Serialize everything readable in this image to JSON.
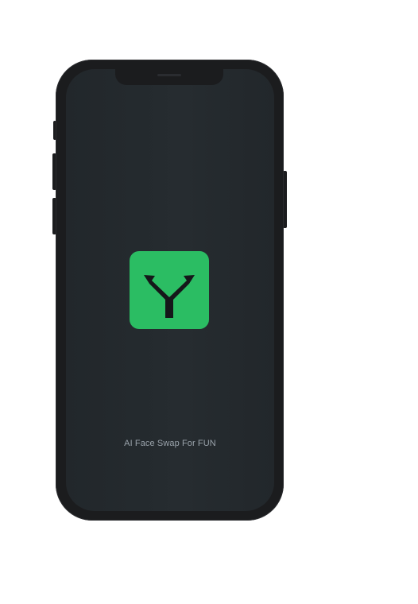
{
  "splash": {
    "tagline": "AI Face Swap For FUN",
    "logo_icon": "y-logo-icon"
  },
  "colors": {
    "screen_background": "#23292d",
    "logo_background": "#2bbd63",
    "logo_glyph": "#15171a",
    "tagline_text": "#9aa3ab",
    "device_frame": "#1b1c1e"
  }
}
